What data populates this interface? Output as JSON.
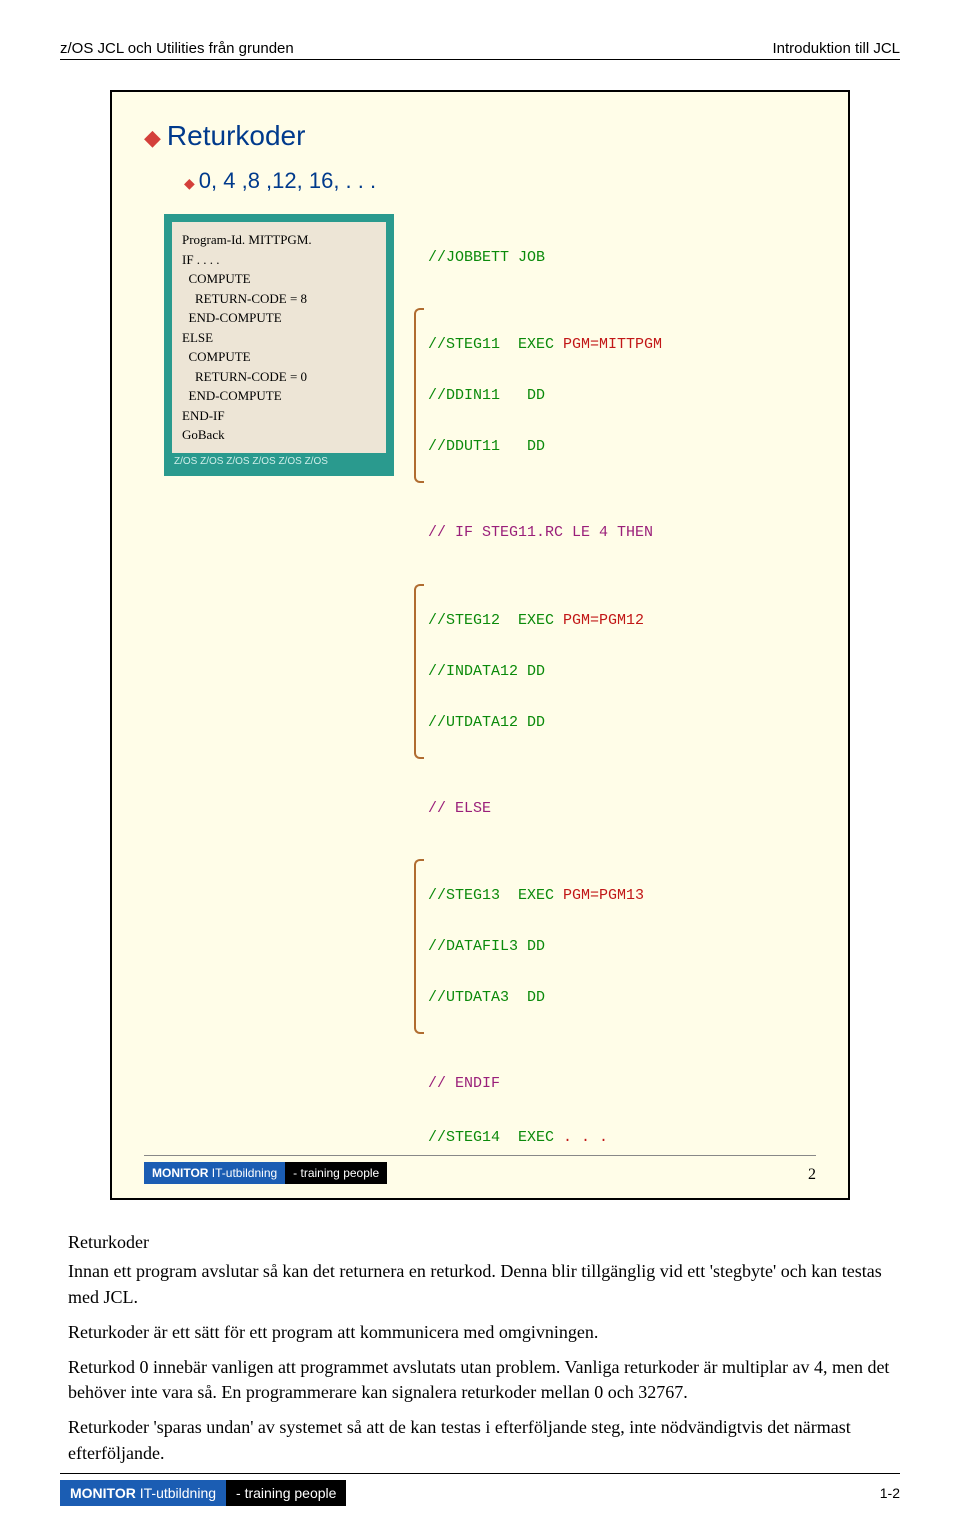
{
  "header": {
    "left": "z/OS JCL och Utilities från grunden",
    "right": "Introduktion till JCL"
  },
  "slide": {
    "title": "Returkoder",
    "subtitle": "0, 4 ,8 ,12, 16, . . .",
    "cobol": "Program-Id. MITTPGM.\nIF . . . .\n  COMPUTE\n    RETURN-CODE = 8\n  END-COMPUTE\nELSE\n  COMPUTE\n    RETURN-CODE = 0\n  END-COMPUTE\nEND-IF\nGoBack",
    "zos_row": "Z/OS Z/OS Z/OS Z/OS Z/OS Z/OS",
    "jcl": {
      "l1": "//JOBBETT JOB",
      "l2a": "//STEG11  EXEC",
      "l2b": " PGM=MITTPGM",
      "l3a": "//DDIN11   DD",
      "l4a": "//DDUT11   DD",
      "l5a": "// IF STEG11.RC LE 4 THEN",
      "l6a": "//STEG12  EXEC",
      "l6b": " PGM=PGM12",
      "l7a": "//INDATA12 DD",
      "l8a": "//UTDATA12 DD",
      "l9a": "// ELSE",
      "l10a": "//STEG13  EXEC",
      "l10b": " PGM=PGM13",
      "l11a": "//DATAFIL3 DD",
      "l12a": "//UTDATA3  DD",
      "l13a": "// ENDIF",
      "l14a": "//STEG14  EXEC",
      "l14b": " . . ."
    },
    "footer": {
      "monitor_brand": "MONITOR",
      "monitor_sub": " IT-utbildning",
      "training": "- training people",
      "num": "2"
    }
  },
  "body": {
    "heading": "Returkoder",
    "p1": "Innan ett program avslutar så kan det returnera en returkod. Denna blir tillgänglig vid ett 'stegbyte' och kan testas med JCL.",
    "p2": "Returkoder är ett sätt för ett program att kommunicera med omgivningen.",
    "p3": "Returkod 0 innebär vanligen att programmet avslutats utan problem. Vanliga returkoder är multiplar av 4, men det behöver inte vara så. En programmerare kan signalera returkoder mellan 0 och 32767.",
    "p4": "Returkoder 'sparas undan' av systemet så att de kan testas i efterföljande steg, inte nödvändigtvis det närmast efterföljande."
  },
  "footer": {
    "monitor_brand": "MONITOR",
    "monitor_sub": " IT-utbildning",
    "training": "- training people",
    "page": "1-2"
  }
}
